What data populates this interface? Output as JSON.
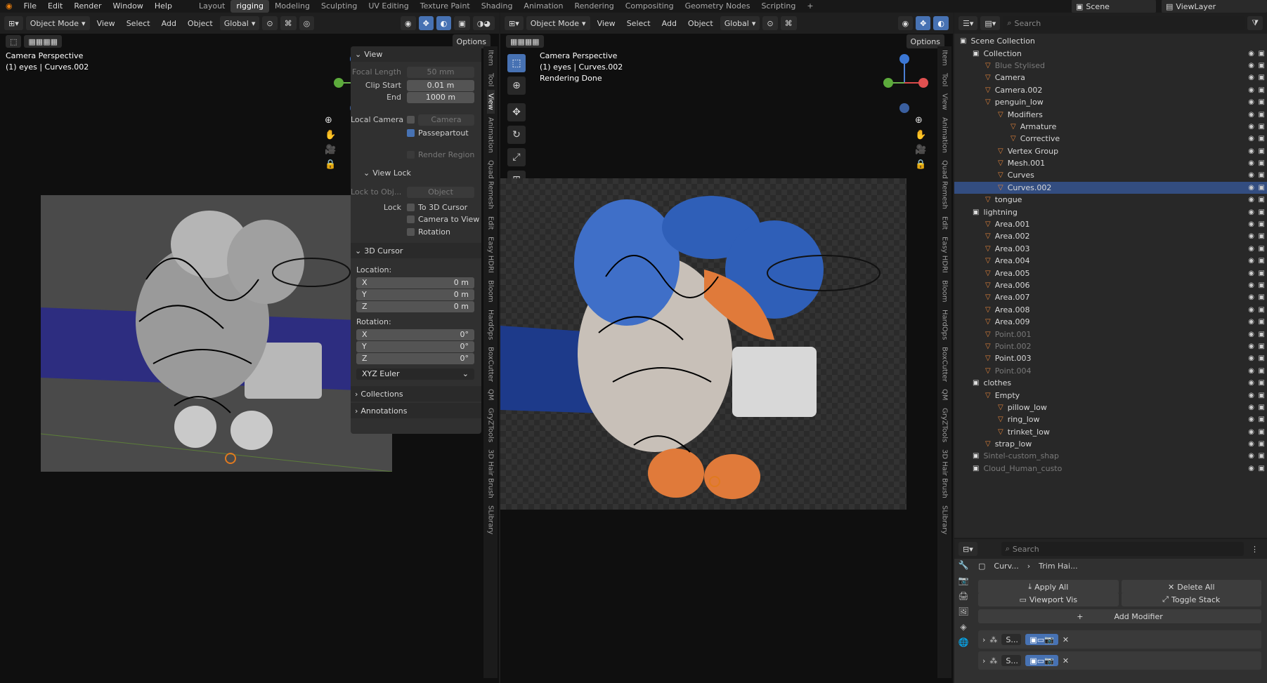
{
  "topbar": {
    "menus": [
      "File",
      "Edit",
      "Render",
      "Window",
      "Help"
    ],
    "workspaces": [
      "Layout",
      "rigging",
      "Modeling",
      "Sculpting",
      "UV Editing",
      "Texture Paint",
      "Shading",
      "Animation",
      "Rendering",
      "Compositing",
      "Geometry Nodes",
      "Scripting"
    ],
    "active_workspace": "rigging",
    "scene": "Scene",
    "view_layer": "ViewLayer"
  },
  "viewport": {
    "mode": "Object Mode",
    "menus": [
      "View",
      "Select",
      "Add",
      "Object"
    ],
    "transform": "Global",
    "options": "Options",
    "left_overlay": [
      "Camera Perspective",
      "(1) eyes | Curves.002"
    ],
    "right_overlay": [
      "Camera Perspective",
      "(1) eyes | Curves.002",
      "Rendering Done"
    ]
  },
  "npanel": {
    "view_header": "View",
    "focal_length_label": "Focal Length",
    "focal_length": "50 mm",
    "clip_start_label": "Clip Start",
    "clip_start": "0.01 m",
    "end_label": "End",
    "clip_end": "1000 m",
    "local_camera_label": "Local Camera",
    "local_camera_value": "Camera",
    "passepartout": "Passepartout",
    "render_region": "Render Region",
    "view_lock_header": "View Lock",
    "lock_to_obj_label": "Lock to Obj...",
    "lock_to_obj_value": "Object",
    "lock_label": "Lock",
    "to_3d_cursor": "To 3D Cursor",
    "camera_to_view": "Camera to View",
    "rotation_chk": "Rotation",
    "cursor_header": "3D Cursor",
    "location_label": "Location:",
    "rotation_label": "Rotation:",
    "loc": [
      {
        "axis": "X",
        "val": "0 m"
      },
      {
        "axis": "Y",
        "val": "0 m"
      },
      {
        "axis": "Z",
        "val": "0 m"
      }
    ],
    "rot": [
      {
        "axis": "X",
        "val": "0°"
      },
      {
        "axis": "Y",
        "val": "0°"
      },
      {
        "axis": "Z",
        "val": "0°"
      }
    ],
    "euler": "XYZ Euler",
    "collections": "Collections",
    "annotations": "Annotations"
  },
  "side_tabs_left": [
    "Item",
    "Tool",
    "View",
    "Animation",
    "Quad Remesh",
    "Edit",
    "Easy HDRI",
    "Bloom",
    "HardOps",
    "BoxCutter",
    "QM",
    "GryZTools",
    "3D Hair Brush",
    "SLibrary"
  ],
  "side_tabs_right": [
    "Item",
    "Tool",
    "View",
    "Animation",
    "Quad Remesh",
    "Edit",
    "Easy HDRI",
    "Bloom",
    "HardOps",
    "BoxCutter",
    "QM",
    "GryZTools",
    "3D Hair Brush",
    "SLibrary"
  ],
  "outliner": {
    "search": "Search",
    "rows": [
      {
        "name": "Scene Collection",
        "indent": 0
      },
      {
        "name": "Collection",
        "indent": 1
      },
      {
        "name": "Blue Stylised",
        "indent": 2,
        "dim": true
      },
      {
        "name": "Camera",
        "indent": 2
      },
      {
        "name": "Camera.002",
        "indent": 2
      },
      {
        "name": "penguin_low",
        "indent": 2
      },
      {
        "name": "Modifiers",
        "indent": 3
      },
      {
        "name": "Armature",
        "indent": 4
      },
      {
        "name": "Corrective",
        "indent": 4
      },
      {
        "name": "Vertex Group",
        "indent": 3
      },
      {
        "name": "Mesh.001",
        "indent": 3
      },
      {
        "name": "Curves",
        "indent": 3
      },
      {
        "name": "Curves.002",
        "indent": 3,
        "sel": true
      },
      {
        "name": "tongue",
        "indent": 2
      },
      {
        "name": "lightning",
        "indent": 1
      },
      {
        "name": "Area.001",
        "indent": 2
      },
      {
        "name": "Area.002",
        "indent": 2
      },
      {
        "name": "Area.003",
        "indent": 2
      },
      {
        "name": "Area.004",
        "indent": 2
      },
      {
        "name": "Area.005",
        "indent": 2
      },
      {
        "name": "Area.006",
        "indent": 2
      },
      {
        "name": "Area.007",
        "indent": 2
      },
      {
        "name": "Area.008",
        "indent": 2
      },
      {
        "name": "Area.009",
        "indent": 2
      },
      {
        "name": "Point.001",
        "indent": 2,
        "dim": true
      },
      {
        "name": "Point.002",
        "indent": 2,
        "dim": true
      },
      {
        "name": "Point.003",
        "indent": 2
      },
      {
        "name": "Point.004",
        "indent": 2,
        "dim": true
      },
      {
        "name": "clothes",
        "indent": 1
      },
      {
        "name": "Empty",
        "indent": 2
      },
      {
        "name": "pillow_low",
        "indent": 3
      },
      {
        "name": "ring_low",
        "indent": 3
      },
      {
        "name": "trinket_low",
        "indent": 3
      },
      {
        "name": "strap_low",
        "indent": 2
      },
      {
        "name": "Sintel-custom_shap",
        "indent": 1,
        "dim": true
      },
      {
        "name": "Cloud_Human_custo",
        "indent": 1,
        "dim": true
      }
    ]
  },
  "properties": {
    "search": "Search",
    "object": "Curv...",
    "modifier": "Trim Hai...",
    "apply_all": "Apply All",
    "delete_all": "Delete All",
    "viewport_vis": "Viewport Vis",
    "toggle_stack": "Toggle Stack",
    "add_modifier": "Add Modifier",
    "mods": [
      "S...",
      "S..."
    ]
  }
}
